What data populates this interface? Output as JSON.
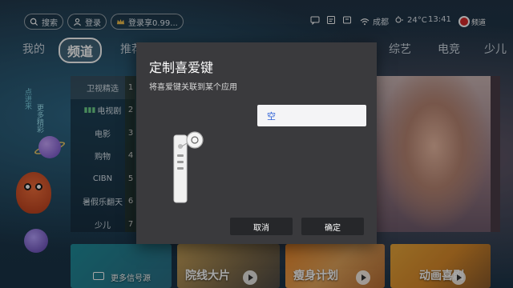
{
  "topbar": {
    "search_label": "搜索",
    "login_label": "登录",
    "promo_label": "登录享0.99...",
    "location": "成都",
    "weather": "24°C",
    "time": "13:41",
    "brand": "频道"
  },
  "tabs": [
    {
      "label": "我的"
    },
    {
      "label": "频道",
      "active": true
    },
    {
      "label": "推荐"
    },
    {
      "label": "综艺"
    },
    {
      "label": "电竞"
    },
    {
      "label": "少儿"
    }
  ],
  "side_decor": {
    "line1": "点进来",
    "line2": "更多精彩"
  },
  "channel_list": {
    "items": [
      "卫视精选",
      "电视剧",
      "电影",
      "购物",
      "CIBN",
      "暑假乐翻天",
      "少儿"
    ],
    "numbers": [
      "1",
      "2",
      "3",
      "4",
      "5",
      "6",
      "7"
    ]
  },
  "cards": [
    {
      "label": "更多信号源"
    },
    {
      "label": "院线大片"
    },
    {
      "label": "瘦身计划"
    },
    {
      "label": "动画喜剧"
    }
  ],
  "dialog": {
    "title": "定制喜爱键",
    "subtitle": "将喜爱键关联到某个应用",
    "field_value": "空",
    "cancel_label": "取消",
    "confirm_label": "确定"
  },
  "colors": {
    "dialog_bg": "#3a3a3d",
    "field_text": "#2b5fd6",
    "button_bg": "#26272a"
  }
}
